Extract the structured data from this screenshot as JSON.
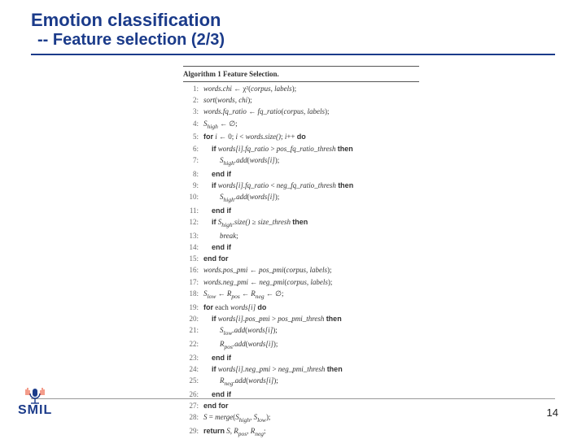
{
  "header": {
    "title": "Emotion classification",
    "subtitle": "-- Feature selection (2/3)"
  },
  "algorithm": {
    "caption": "Algorithm 1 Feature Selection.",
    "lines": [
      {
        "n": "1:",
        "indent": 0,
        "html": "<span class='it'>words.chi</span> ← χ²(<span class='it'>corpus, labels</span>);"
      },
      {
        "n": "2:",
        "indent": 0,
        "html": "<span class='it'>sort</span>(<span class='it'>words, chi</span>);"
      },
      {
        "n": "3:",
        "indent": 0,
        "html": "<span class='it'>words.fq_ratio</span> ← <span class='it'>fq_ratio</span>(<span class='it'>corpus, labels</span>);"
      },
      {
        "n": "4:",
        "indent": 0,
        "html": "<span class='it'>S<sub>high</sub></span> ← ∅;"
      },
      {
        "n": "5:",
        "indent": 0,
        "html": "<span class='kw'>for</span> <span class='it'>i</span> ← 0; <span class='it'>i</span> &lt; <span class='it'>words.size()</span>; <span class='it'>i</span>++ <span class='kw'>do</span>"
      },
      {
        "n": "6:",
        "indent": 1,
        "html": "<span class='kw'>if</span> <span class='it'>words[i].fq_ratio</span> &gt; <span class='it'>pos_fq_ratio_thresh</span> <span class='kw'>then</span>"
      },
      {
        "n": "7:",
        "indent": 2,
        "html": "<span class='it'>S<sub>high</sub>.add</span>(<span class='it'>words[i]</span>);"
      },
      {
        "n": "8:",
        "indent": 1,
        "html": "<span class='kw'>end if</span>"
      },
      {
        "n": "9:",
        "indent": 1,
        "html": "<span class='kw'>if</span> <span class='it'>words[i].fq_ratio</span> &lt; <span class='it'>neg_fq_ratio_thresh</span> <span class='kw'>then</span>"
      },
      {
        "n": "10:",
        "indent": 2,
        "html": "<span class='it'>S<sub>high</sub>.add</span>(<span class='it'>words[i]</span>);"
      },
      {
        "n": "11:",
        "indent": 1,
        "html": "<span class='kw'>end if</span>"
      },
      {
        "n": "12:",
        "indent": 1,
        "html": "<span class='kw'>if</span> <span class='it'>S<sub>high</sub>.size()</span> ≥ <span class='it'>size_thresh</span> <span class='kw'>then</span>"
      },
      {
        "n": "13:",
        "indent": 2,
        "html": "<span class='it'>break</span>;"
      },
      {
        "n": "14:",
        "indent": 1,
        "html": "<span class='kw'>end if</span>"
      },
      {
        "n": "15:",
        "indent": 0,
        "html": "<span class='kw'>end for</span>"
      },
      {
        "n": "16:",
        "indent": 0,
        "html": "<span class='it'>words.pos_pmi</span> ← <span class='it'>pos_pmi</span>(<span class='it'>corpus, labels</span>);"
      },
      {
        "n": "17:",
        "indent": 0,
        "html": "<span class='it'>words.neg_pmi</span> ← <span class='it'>neg_pmi</span>(<span class='it'>corpus, labels</span>);"
      },
      {
        "n": "18:",
        "indent": 0,
        "html": "<span class='it'>S<sub>low</sub></span> ← <span class='it'>R<sub>pos</sub></span> ← <span class='it'>R<sub>neg</sub></span> ← ∅;"
      },
      {
        "n": "19:",
        "indent": 0,
        "html": "<span class='kw'>for</span> each <span class='it'>words[i]</span> <span class='kw'>do</span>"
      },
      {
        "n": "20:",
        "indent": 1,
        "html": "<span class='kw'>if</span> <span class='it'>words[i].pos_pmi</span> &gt; <span class='it'>pos_pmi_thresh</span> <span class='kw'>then</span>"
      },
      {
        "n": "21:",
        "indent": 2,
        "html": "<span class='it'>S<sub>low</sub>.add</span>(<span class='it'>words[i]</span>);"
      },
      {
        "n": "22:",
        "indent": 2,
        "html": "<span class='it'>R<sub>pos</sub>.add</span>(<span class='it'>words[i]</span>);"
      },
      {
        "n": "23:",
        "indent": 1,
        "html": "<span class='kw'>end if</span>"
      },
      {
        "n": "24:",
        "indent": 1,
        "html": "<span class='kw'>if</span> <span class='it'>words[i].neg_pmi</span> &gt; <span class='it'>neg_pmi_thresh</span> <span class='kw'>then</span>"
      },
      {
        "n": "25:",
        "indent": 2,
        "html": "<span class='it'>R<sub>neg</sub>.add</span>(<span class='it'>words[i]</span>);"
      },
      {
        "n": "26:",
        "indent": 1,
        "html": "<span class='kw'>end if</span>"
      },
      {
        "n": "27:",
        "indent": 0,
        "html": "<span class='kw'>end for</span>"
      },
      {
        "n": "28:",
        "indent": 0,
        "html": "<span class='it'>S</span> = <span class='it'>merge</span>(<span class='it'>S<sub>high</sub>, S<sub>low</sub></span>);"
      },
      {
        "n": "29:",
        "indent": 0,
        "html": "<span class='kw'>return</span> <span class='it'>S, R<sub>pos</sub>, R<sub>neg</sub></span>;"
      }
    ]
  },
  "footer": {
    "brand": "SMIL",
    "page_number": "14"
  }
}
